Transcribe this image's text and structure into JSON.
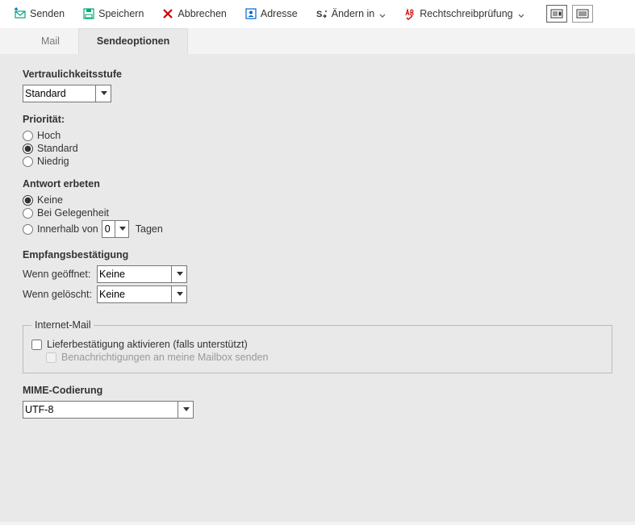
{
  "toolbar": {
    "send": "Senden",
    "save": "Speichern",
    "cancel": "Abbrechen",
    "address": "Adresse",
    "change_in": "Ändern in",
    "spellcheck": "Rechtschreibprüfung"
  },
  "tabs": {
    "mail": "Mail",
    "send_options": "Sendeoptionen"
  },
  "conf": {
    "label": "Vertraulichkeitsstufe",
    "value": "Standard",
    "options": [
      "Standard"
    ]
  },
  "priority": {
    "label": "Priorität:",
    "high": "Hoch",
    "standard": "Standard",
    "low": "Niedrig",
    "selected": "standard"
  },
  "reply": {
    "label": "Antwort erbeten",
    "none": "Keine",
    "convenient": "Bei Gelegenheit",
    "within_prefix": "Innerhalb von",
    "within_value": "0",
    "within_suffix": "Tagen",
    "selected": "none"
  },
  "receipt": {
    "label": "Empfangsbestätigung",
    "when_opened": "Wenn geöffnet:",
    "when_deleted": "Wenn gelöscht:",
    "opened_value": "Keine",
    "deleted_value": "Keine",
    "options": [
      "Keine"
    ]
  },
  "internet": {
    "legend": "Internet-Mail",
    "delivery_cb": "Lieferbestätigung aktivieren (falls unterstützt)",
    "notify_cb": "Benachrichtigungen an meine Mailbox senden",
    "delivery_checked": false,
    "notify_checked": false
  },
  "mime": {
    "label": "MIME-Codierung",
    "value": "UTF-8",
    "options": [
      "UTF-8"
    ]
  }
}
